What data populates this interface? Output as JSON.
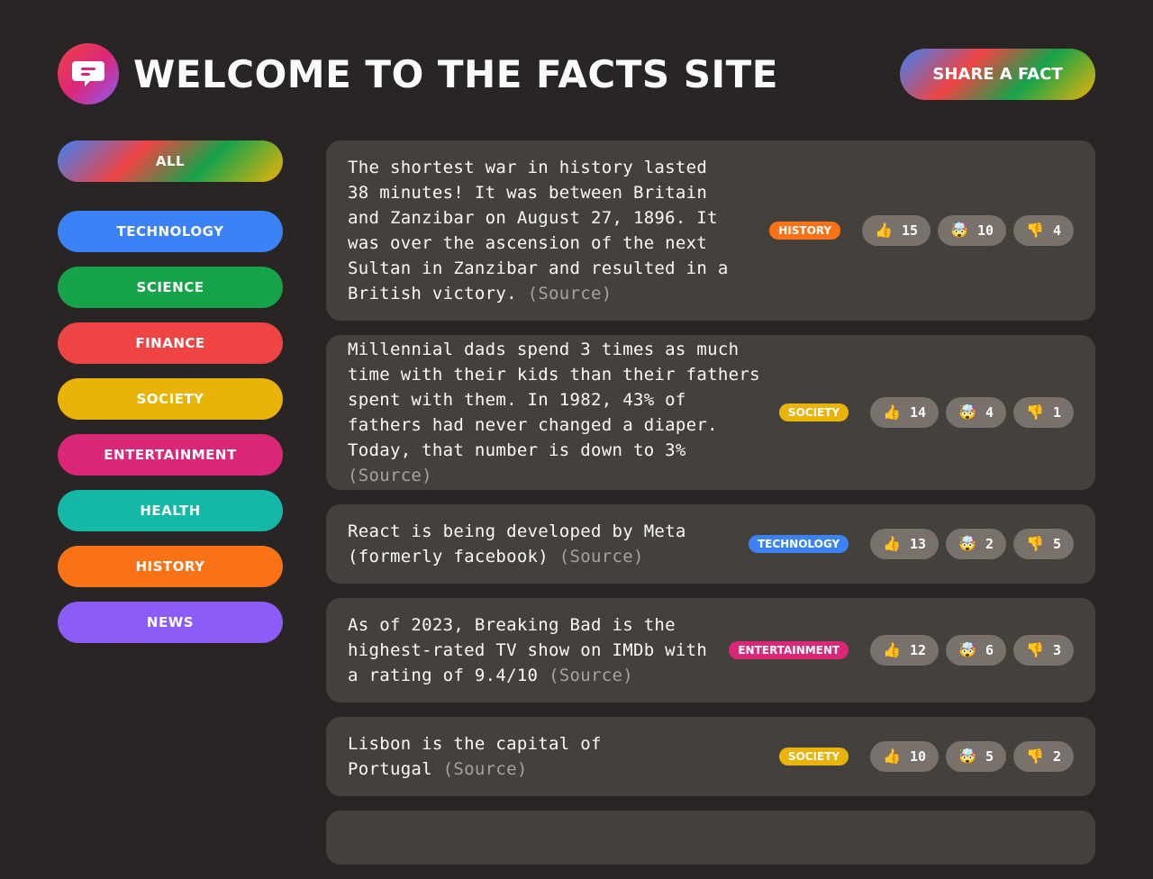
{
  "header": {
    "title": "Welcome to the facts site",
    "share_label": "Share a fact",
    "logo_icon": "speech-bubble-icon"
  },
  "sidebar": {
    "items": [
      {
        "label": "All",
        "color": "gradient"
      },
      {
        "label": "Technology",
        "color": "#3b82f6"
      },
      {
        "label": "Science",
        "color": "#16a34a"
      },
      {
        "label": "Finance",
        "color": "#ef4444"
      },
      {
        "label": "Society",
        "color": "#eab308"
      },
      {
        "label": "Entertainment",
        "color": "#db2777"
      },
      {
        "label": "Health",
        "color": "#14b8a6"
      },
      {
        "label": "History",
        "color": "#f97316"
      },
      {
        "label": "News",
        "color": "#8b5cf6"
      }
    ]
  },
  "facts": [
    {
      "text": "The shortest war in history lasted 38 minutes! It was between Britain and Zanzibar on August 27, 1896. It was over the ascension of the next Sultan in Zanzibar and resulted in a British victory.",
      "source": "(Source)",
      "category": "History",
      "category_color": "#f97316",
      "votes": {
        "interesting": "15",
        "mindblowing": "10",
        "false": "4"
      }
    },
    {
      "text": "Millennial dads spend 3 times as much time with their kids than their fathers spent with them. In 1982, 43% of fathers had never changed a diaper. Today, that number is down to 3%",
      "source": "(Source)",
      "category": "Society",
      "category_color": "#eab308",
      "votes": {
        "interesting": "14",
        "mindblowing": "4",
        "false": "1"
      }
    },
    {
      "text": "React is being developed by Meta (formerly facebook)",
      "source": "(Source)",
      "category": "Technology",
      "category_color": "#3b82f6",
      "votes": {
        "interesting": "13",
        "mindblowing": "2",
        "false": "5"
      }
    },
    {
      "text": "As of 2023, Breaking Bad is the highest-rated TV show on IMDb with a rating of 9.4/10",
      "source": "(Source)",
      "category": "Entertainment",
      "category_color": "#db2777",
      "votes": {
        "interesting": "12",
        "mindblowing": "6",
        "false": "3"
      }
    },
    {
      "text": "Lisbon is the capital of Portugal",
      "source": "(Source)",
      "category": "Society",
      "category_color": "#eab308",
      "votes": {
        "interesting": "10",
        "mindblowing": "5",
        "false": "2"
      }
    }
  ],
  "icons": {
    "thumbs_up": "👍",
    "mind_blown": "🤯",
    "thumbs_down": "👎"
  }
}
